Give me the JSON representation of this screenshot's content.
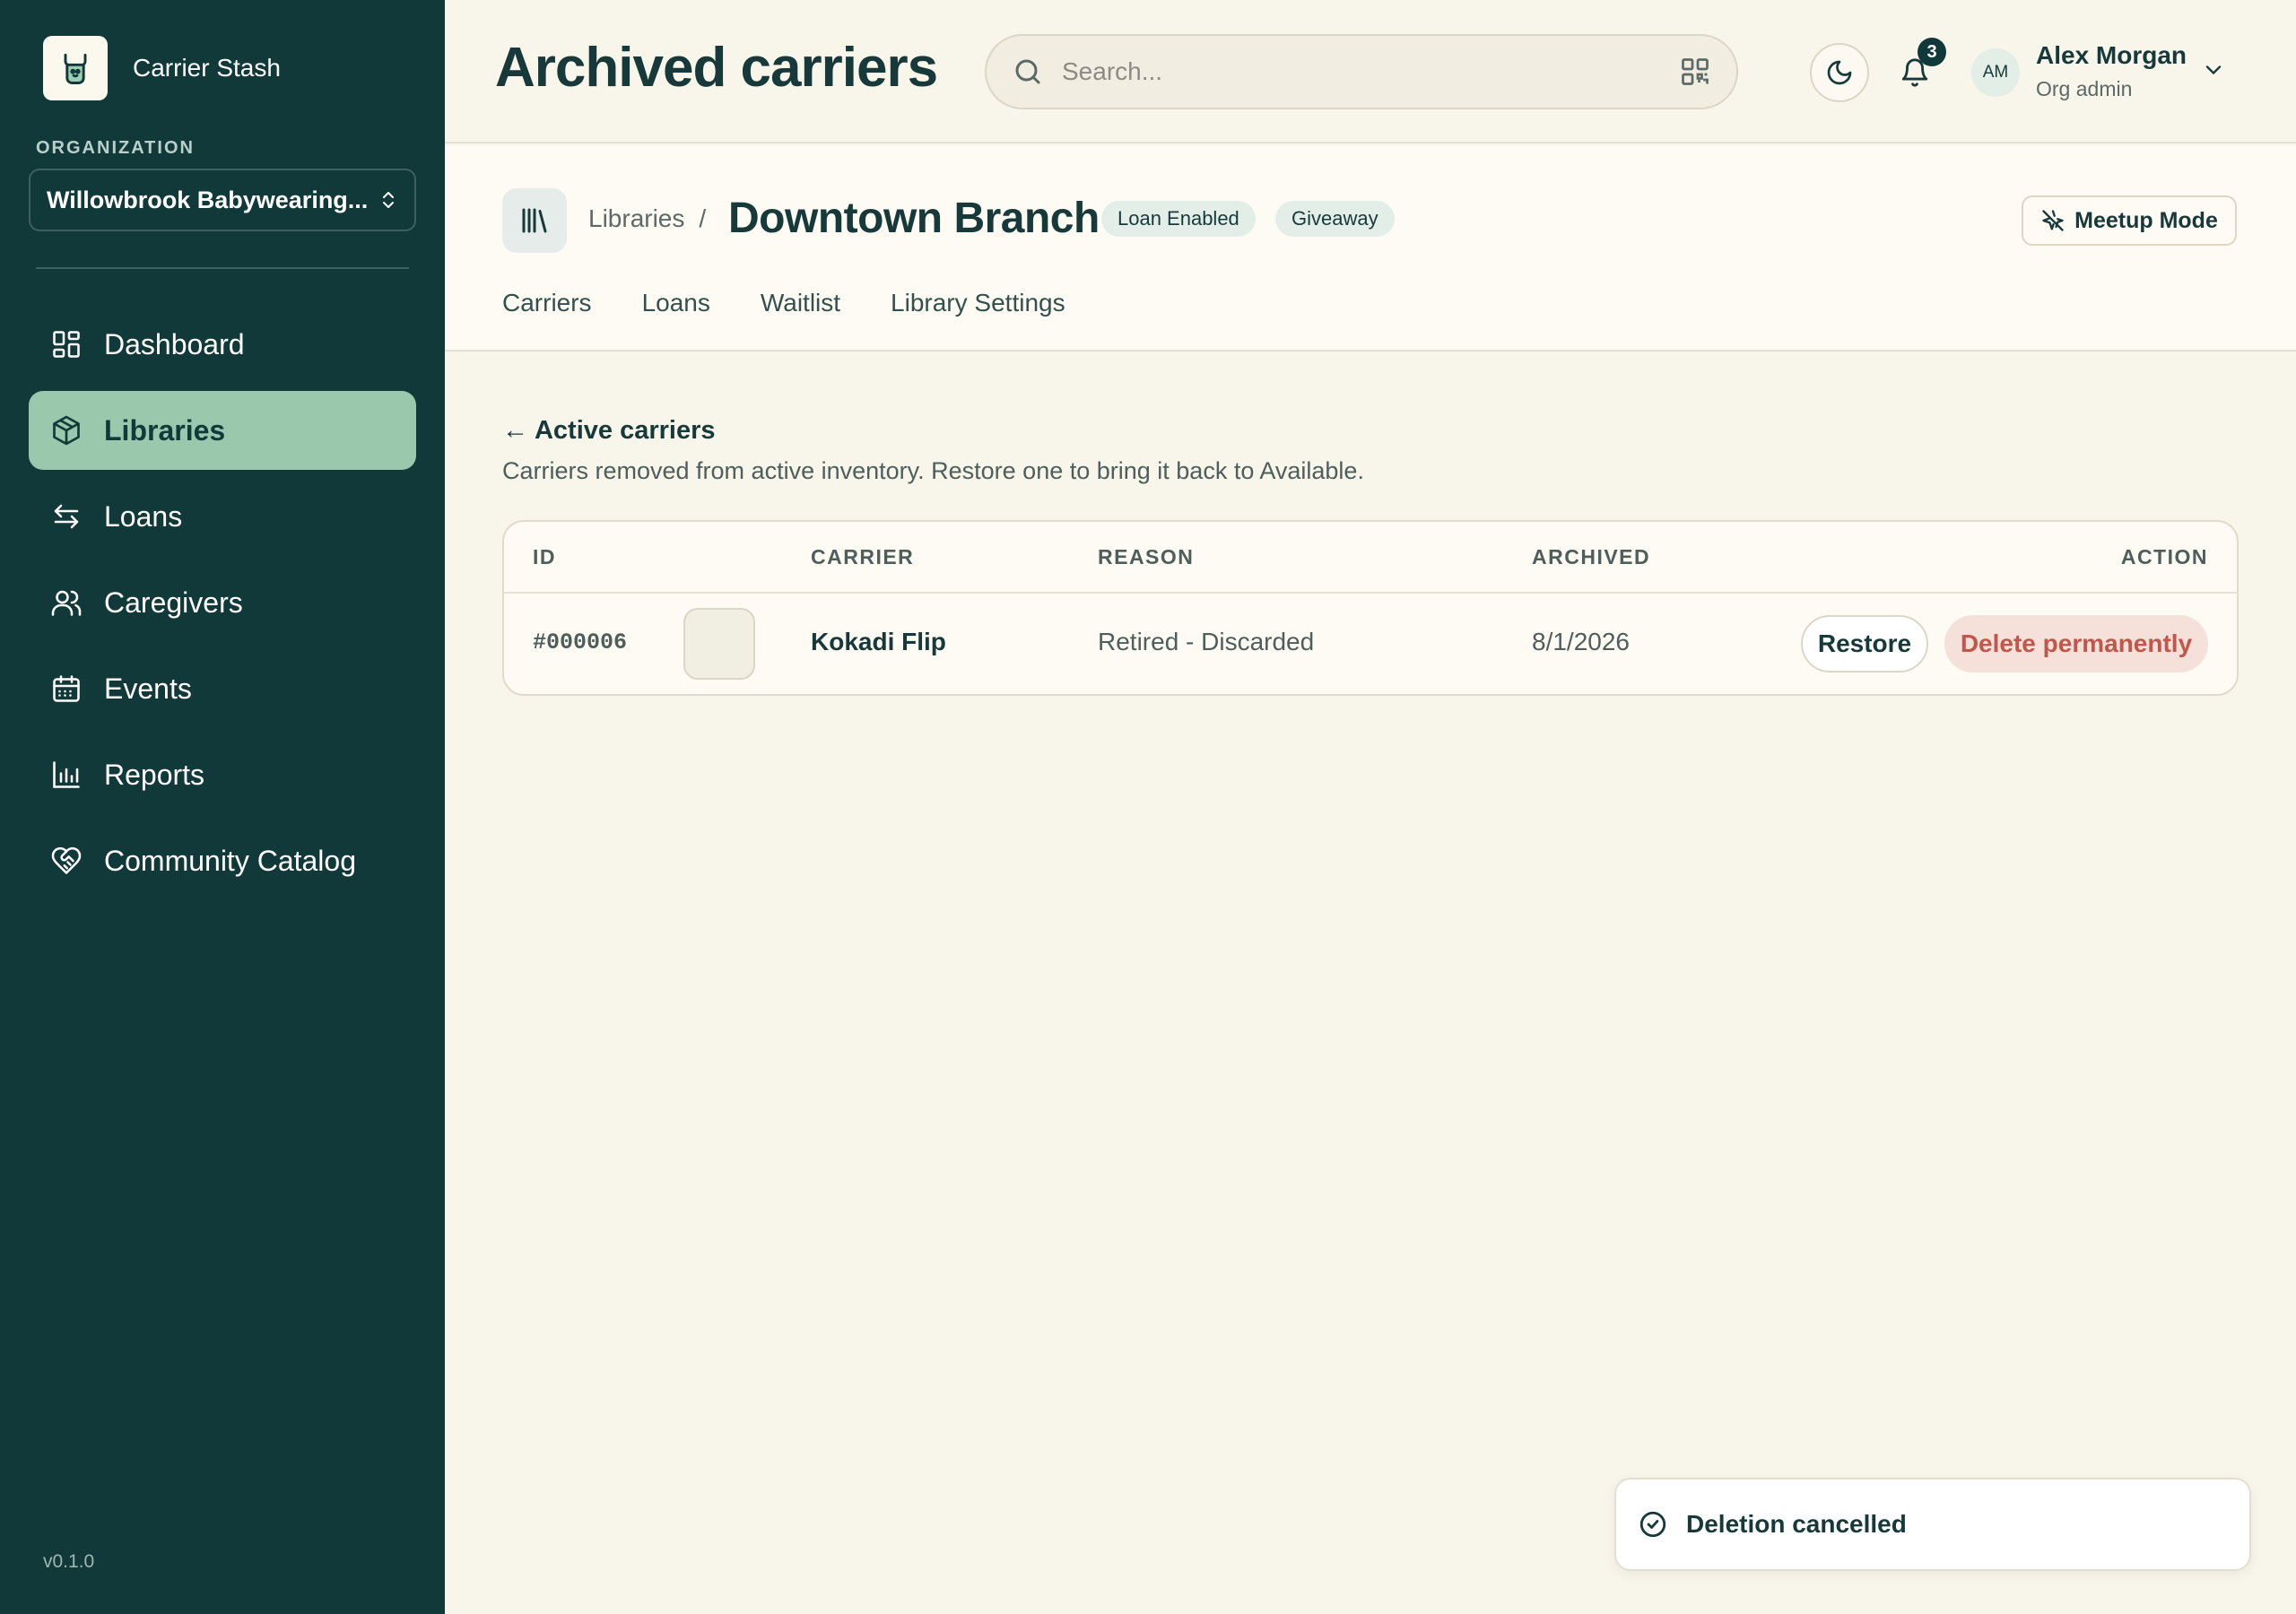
{
  "app": {
    "name": "Carrier Stash",
    "version": "v0.1.0"
  },
  "organization": {
    "label": "ORGANIZATION",
    "selected": "Willowbrook Babywearing..."
  },
  "sidebar": {
    "items": [
      {
        "label": "Dashboard",
        "icon": "dashboard-icon",
        "active": false
      },
      {
        "label": "Libraries",
        "icon": "box-icon",
        "active": true
      },
      {
        "label": "Loans",
        "icon": "swap-arrows-icon",
        "active": false
      },
      {
        "label": "Caregivers",
        "icon": "users-icon",
        "active": false
      },
      {
        "label": "Events",
        "icon": "calendar-icon",
        "active": false
      },
      {
        "label": "Reports",
        "icon": "bar-chart-icon",
        "active": false
      },
      {
        "label": "Community Catalog",
        "icon": "heart-handshake-icon",
        "active": false
      }
    ]
  },
  "header": {
    "title": "Archived carriers",
    "search_placeholder": "Search...",
    "notification_count": "3",
    "user": {
      "initials": "AM",
      "name": "Alex Morgan",
      "role": "Org admin"
    }
  },
  "library": {
    "breadcrumb_parent": "Libraries",
    "breadcrumb_separator": "/",
    "name": "Downtown Branch",
    "tags": [
      "Loan Enabled",
      "Giveaway"
    ],
    "meetup_button": "Meetup Mode",
    "tabs": [
      "Carriers",
      "Loans",
      "Waitlist",
      "Library Settings"
    ]
  },
  "main": {
    "back_link": "← Active carriers",
    "description": "Carriers removed from active inventory. Restore one to bring it back to Available.",
    "table": {
      "columns": [
        "ID",
        "CARRIER",
        "REASON",
        "ARCHIVED",
        "ACTION"
      ],
      "rows": [
        {
          "id": "#000006",
          "carrier": "Kokadi Flip",
          "reason": "Retired - Discarded",
          "archived": "8/1/2026",
          "restore_label": "Restore",
          "delete_label": "Delete permanently"
        }
      ]
    }
  },
  "toast": {
    "message": "Deletion cancelled"
  },
  "colors": {
    "sidebar_bg": "#12393a",
    "active_nav": "#99c8ac",
    "page_bg": "#f8f5eb",
    "danger": "#c0574a"
  }
}
